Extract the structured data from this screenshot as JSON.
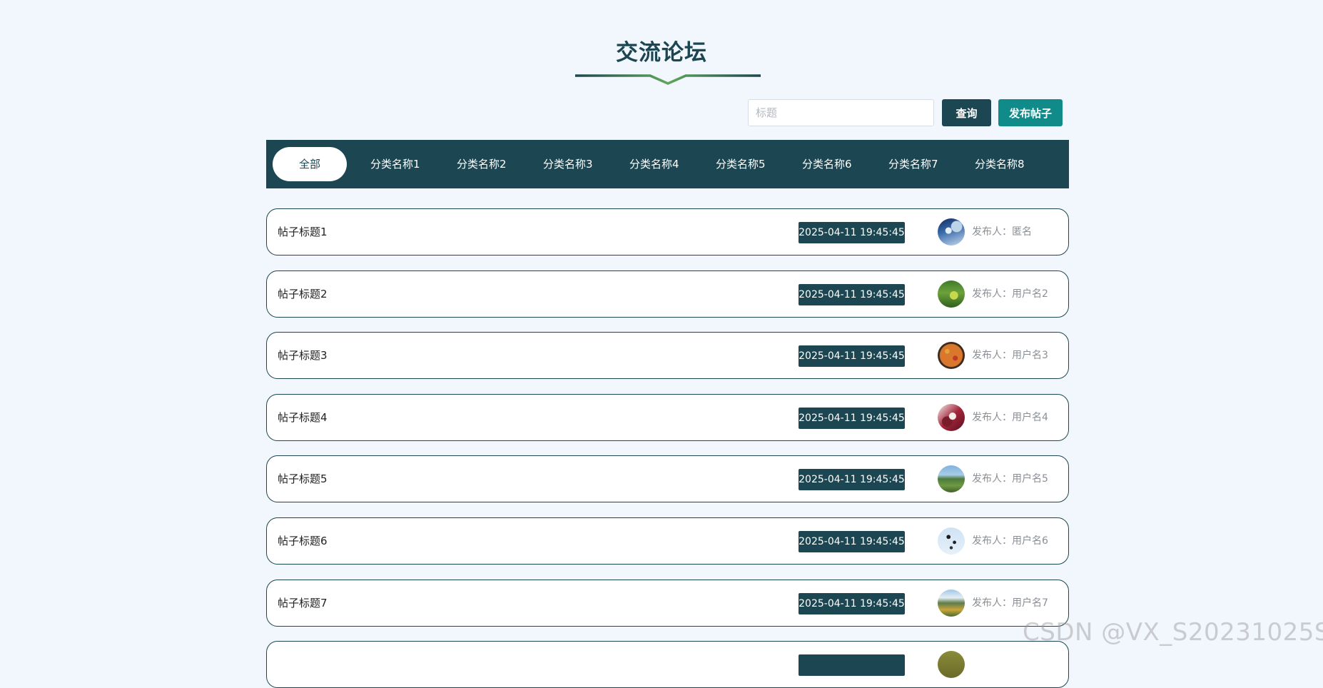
{
  "page": {
    "title": "交流论坛",
    "accent_color": "#1c4651",
    "accent_secondary": "#118a8a",
    "deco_color": "#5fa65a"
  },
  "search": {
    "placeholder": "标题",
    "value": "",
    "query_label": "查询",
    "post_label": "发布帖子"
  },
  "categories": {
    "items": [
      "全部",
      "分类名称1",
      "分类名称2",
      "分类名称3",
      "分类名称4",
      "分类名称5",
      "分类名称6",
      "分类名称7",
      "分类名称8"
    ],
    "active": "全部"
  },
  "posts": [
    {
      "title": "帖子标题1",
      "time": "2025-04-11 19:45:45",
      "author": "发布人：匿名",
      "avatar": "sky-bird-photo"
    },
    {
      "title": "帖子标题2",
      "time": "2025-04-11 19:45:45",
      "author": "发布人：用户名2",
      "avatar": "green-field-photo"
    },
    {
      "title": "帖子标题3",
      "time": "2025-04-11 19:45:45",
      "author": "发布人：用户名3",
      "avatar": "pizza-photo"
    },
    {
      "title": "帖子标题4",
      "time": "2025-04-11 19:45:45",
      "author": "发布人：用户名4",
      "avatar": "berries-photo"
    },
    {
      "title": "帖子标题5",
      "time": "2025-04-11 19:45:45",
      "author": "发布人：用户名5",
      "avatar": "landscape-photo"
    },
    {
      "title": "帖子标题6",
      "time": "2025-04-11 19:45:45",
      "author": "发布人：用户名6",
      "avatar": "ink-flower-photo"
    },
    {
      "title": "帖子标题7",
      "time": "2025-04-11 19:45:45",
      "author": "发布人：用户名7",
      "avatar": "mountain-lake-photo"
    },
    {
      "title": "",
      "time": "",
      "author": "",
      "avatar": "olive-photo"
    }
  ],
  "watermark": "CSDN @VX_S20231025S"
}
